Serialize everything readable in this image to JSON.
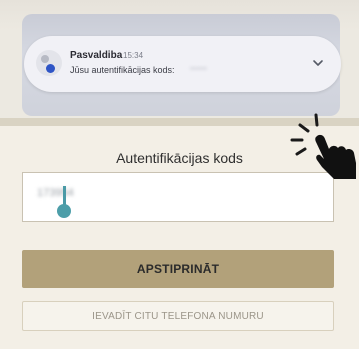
{
  "notification": {
    "sender": "Pasvaldiba",
    "time": "15:34",
    "message": "Jūsu autentifikācijas kods:",
    "code": "••••••",
    "avatar_icon": "messages-app-icon",
    "chevron_icon": "chevron-down-icon"
  },
  "form": {
    "field_label": "Autentifikācijas kods",
    "code_value": "173954",
    "confirm_label": "APSTIPRINĀT",
    "alt_label": "IEVADĪT CITU TELEFONA NUMURU"
  },
  "colors": {
    "confirm_button": "#b2a17a",
    "caret": "#4d9ea9",
    "page_background": "#f1ede4"
  },
  "pointer": {
    "icon": "tap-hand-icon"
  }
}
